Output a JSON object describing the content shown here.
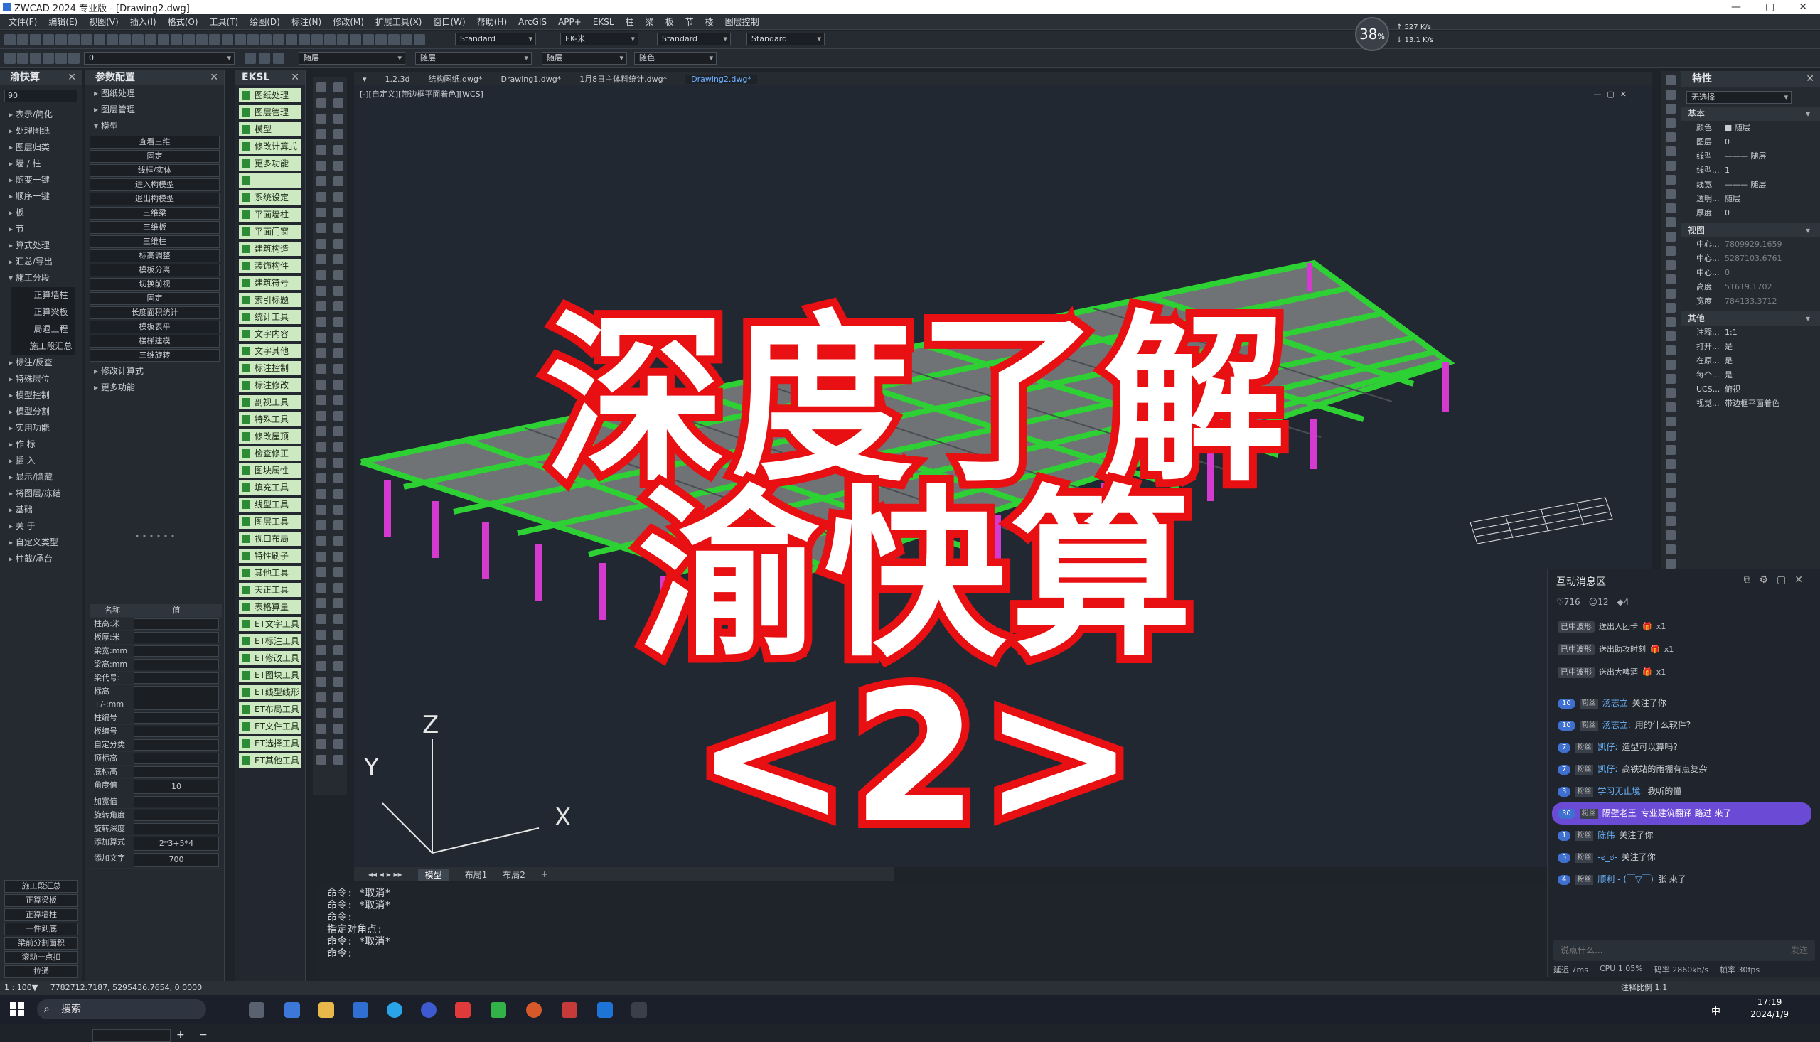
{
  "window": {
    "title": "ZWCAD 2024 专业版 - [Drawing2.dwg]",
    "minimize": "—",
    "maximize": "▢",
    "close": "✕"
  },
  "menu": [
    "文件(F)",
    "编辑(E)",
    "视图(V)",
    "插入(I)",
    "格式(O)",
    "工具(T)",
    "绘图(D)",
    "标注(N)",
    "修改(M)",
    "扩展工具(X)",
    "窗口(W)",
    "帮助(H)",
    "ArcGIS",
    "APP+",
    "EKSL",
    "柱",
    "梁",
    "板",
    "节",
    "楼",
    "图层控制"
  ],
  "toolbar": {
    "style1": "Standard",
    "style2": "EK-米",
    "style3": "Standard",
    "style4": "Standard",
    "layer": "0",
    "color": "随层",
    "linetype": "随层",
    "lineweight": "随层",
    "plotstyle": "随色"
  },
  "speed": {
    "percent": "38",
    "unit": "%",
    "up": "527",
    "up_unit": "K/s",
    "down": "13.1",
    "down_unit": "K/s"
  },
  "left_panel": {
    "title": "渝快算",
    "search": "90",
    "items": [
      "表示/简化",
      "处理图纸",
      "图层归类",
      "墙 / 柱",
      "随变一键",
      "顺序一键",
      "板",
      "节",
      "算式处理",
      "汇总/导出",
      "施工分段",
      "标注/反查",
      "特殊层位",
      "模型控制",
      "模型分割",
      "实用功能",
      "作 标",
      "插 入",
      "显示/隐藏",
      "将图层/冻结",
      "基础",
      "关 于",
      "自定义类型",
      "柱截/承台"
    ],
    "sub": [
      "正算墙柱",
      "正算梁板",
      "局退工程",
      "施工段汇总"
    ],
    "bottom": [
      "施工段汇总",
      "正算梁板",
      "正算墙柱",
      "一件到底",
      "梁前分割面积",
      "滚动一点扣",
      "拉通"
    ]
  },
  "param_panel": {
    "title": "参数配置",
    "items": [
      "图纸处理",
      "图层管理",
      "模型"
    ],
    "buttons": [
      "查看三维",
      "固定",
      "线框/实体",
      "进入构模型",
      "退出构模型",
      "三维梁",
      "三维板",
      "三维柱",
      "标高调整",
      "模板分离",
      "切换前视",
      "固定",
      "长度面积统计",
      "模板表平",
      "楼梯建模",
      "三维旋转"
    ],
    "items2": [
      "修改计算式",
      "更多功能"
    ],
    "table_head": [
      "名称",
      "值"
    ],
    "props": [
      [
        "柱高:米",
        ""
      ],
      [
        "板厚:米",
        ""
      ],
      [
        "梁宽:mm",
        ""
      ],
      [
        "梁高:mm",
        ""
      ],
      [
        "梁代号:",
        ""
      ],
      [
        "标高+/-:mm",
        ""
      ],
      [
        "柱编号",
        ""
      ],
      [
        "板编号",
        ""
      ],
      [
        "自定分类",
        ""
      ],
      [
        "顶标高",
        ""
      ],
      [
        "底标高",
        ""
      ],
      [
        "角度值",
        "10"
      ],
      [
        "加宽值",
        ""
      ],
      [
        "旋转角度",
        ""
      ],
      [
        "旋转深度",
        ""
      ],
      [
        "添加算式",
        "2*3+5*4"
      ],
      [
        "添加文字",
        "700"
      ]
    ]
  },
  "eksl": {
    "title": "EKSL",
    "items": [
      "图纸处理",
      "图层管理",
      "模型",
      "修改计算式",
      "更多功能",
      "----------",
      "系统设定",
      "平面墙柱",
      "平面门窗",
      "建筑构造",
      "装饰构件",
      "建筑符号",
      "索引标题",
      "统计工具",
      "文字内容",
      "文字其他",
      "标注控制",
      "标注修改",
      "剖视工具",
      "特殊工具",
      "修改屋顶",
      "检查修正",
      "图块属性",
      "填充工具",
      "线型工具",
      "图层工具",
      "视口布局",
      "特性刷子",
      "其他工具",
      "天正工具",
      "表格算量",
      "ET文字工具",
      "ET标注工具",
      "ET修改工具",
      "ET图块工具",
      "ET线型线形",
      "ET布局工具",
      "ET文件工具",
      "ET选择工具",
      "ET其他工具"
    ]
  },
  "tabs": [
    "1.2.3d",
    "结构图纸.dwg*",
    "Drawing1.dwg*",
    "1月8日主体料统计.dwg*",
    "Drawing2.dwg*"
  ],
  "viewport_label": "[-][自定义][带边框平面着色][WCS]",
  "axes": {
    "x": "X",
    "y": "Y",
    "z": "Z"
  },
  "overlay": {
    "line1": "深度了解",
    "line2": "渝快算<2>"
  },
  "layout_tabs": [
    "模型",
    "布局1",
    "布局2",
    "+"
  ],
  "command": [
    "命令: *取消*",
    "命令: *取消*",
    "命令:",
    "指定对角点:",
    "命令: *取消*",
    "",
    "命令:"
  ],
  "statusbar": {
    "scale": "1 : 100▼",
    "coords": "7782712.7187, 5295436.7654, 0.0000",
    "anno": "注释比例 1:1"
  },
  "properties": {
    "title": "特性",
    "selection": "无选择",
    "sec_basic": "基本",
    "basic": [
      [
        "颜色",
        "■ 随层"
      ],
      [
        "图层",
        "0"
      ],
      [
        "线型",
        "——— 随层"
      ],
      [
        "线型...",
        "1"
      ],
      [
        "线宽",
        "——— 随层"
      ],
      [
        "透明...",
        "随层"
      ],
      [
        "厚度",
        "0"
      ]
    ],
    "sec_view": "视图",
    "view": [
      [
        "中心...",
        "7809929.1659"
      ],
      [
        "中心...",
        "5287103.6761"
      ],
      [
        "中心...",
        "0"
      ],
      [
        "高度",
        "51619.1702"
      ],
      [
        "宽度",
        "784133.3712"
      ]
    ],
    "sec_other": "其他",
    "other": [
      [
        "注释...",
        "1:1"
      ],
      [
        "打开...",
        "是"
      ],
      [
        "在原...",
        "是"
      ],
      [
        "每个...",
        "是"
      ],
      [
        "UCS...",
        "俯视"
      ],
      [
        "视觉...",
        "带边框平面着色"
      ]
    ]
  },
  "chat": {
    "title": "互动消息区",
    "likes": "716",
    "viewers": "12",
    "count": "4",
    "gifts": [
      [
        "已中波形",
        "送出人团卡",
        "x1"
      ],
      [
        "已中波形",
        "送出助攻时刻",
        "x1"
      ],
      [
        "已中波形",
        "送出大啤酒",
        "x1"
      ]
    ],
    "messages": [
      {
        "lv": "10",
        "user": "汤志立",
        "text": "关注了你"
      },
      {
        "lv": "10",
        "user": "汤志立:",
        "text": "用的什么软件?"
      },
      {
        "lv": "7",
        "user": "凯仔:",
        "text": "造型可以算吗?"
      },
      {
        "lv": "7",
        "user": "凯仔:",
        "text": "高铁站的雨棚有点复杂"
      },
      {
        "lv": "3",
        "user": "学习无止境:",
        "text": "我听的懂"
      },
      {
        "lv": "30",
        "user": "隔壁老王",
        "text": "专业建筑翻译 路过 来了",
        "hl": true
      },
      {
        "lv": "1",
        "user": "陈伟",
        "text": "关注了你"
      },
      {
        "lv": "5",
        "user": "-ಠ_ಠ-",
        "text": "关注了你"
      },
      {
        "lv": "4",
        "user": "顺利 - (￣▽￣)",
        "text": "张 来了"
      }
    ],
    "input_placeholder": "说点什么...",
    "send": "发送",
    "footer": [
      "延迟 7ms",
      "CPU 1.05%",
      "码率 2860kb/s",
      "帧率 30fps"
    ]
  },
  "taskbar": {
    "search": "搜索",
    "time": "17:19",
    "date": "2024/1/9",
    "ime": "中"
  }
}
